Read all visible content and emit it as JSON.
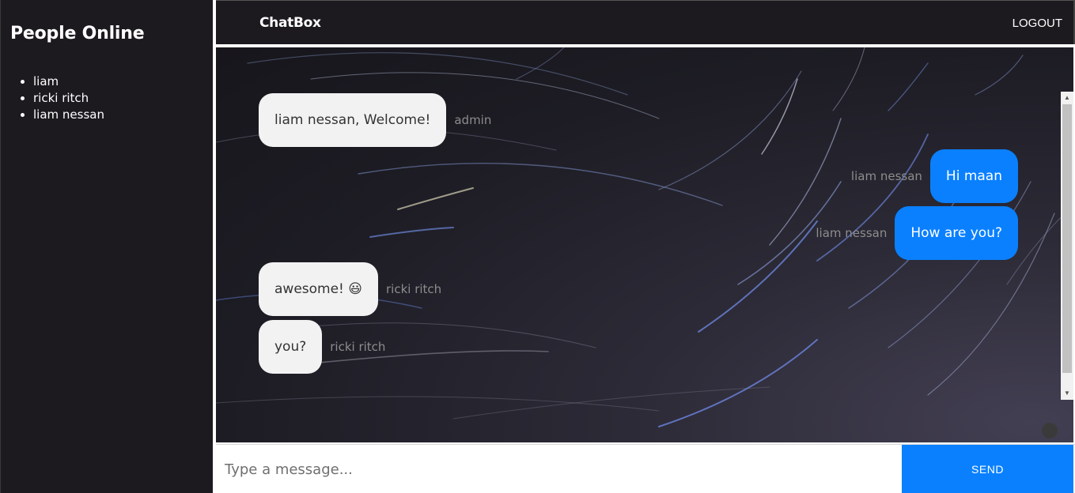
{
  "sidebar": {
    "title": "People Online",
    "people": [
      "liam",
      "ricki ritch",
      "liam nessan"
    ]
  },
  "header": {
    "brand": "ChatBox",
    "logout_label": "LOGOUT"
  },
  "messages": [
    {
      "side": "left",
      "text": "liam nessan, Welcome!",
      "sender": "admin"
    },
    {
      "side": "right",
      "text": "Hi maan",
      "sender": "liam nessan"
    },
    {
      "side": "right",
      "text": "How are you?",
      "sender": "liam nessan"
    },
    {
      "side": "left",
      "text": "awesome! 😃",
      "sender": "ricki ritch"
    },
    {
      "side": "left",
      "text": "you?",
      "sender": "ricki ritch"
    }
  ],
  "composer": {
    "placeholder": "Type a message...",
    "send_label": "SEND"
  },
  "colors": {
    "sidebar_bg": "#1c1a1f",
    "accent": "#0a80ff",
    "incoming_bubble": "#f2f2f2"
  }
}
